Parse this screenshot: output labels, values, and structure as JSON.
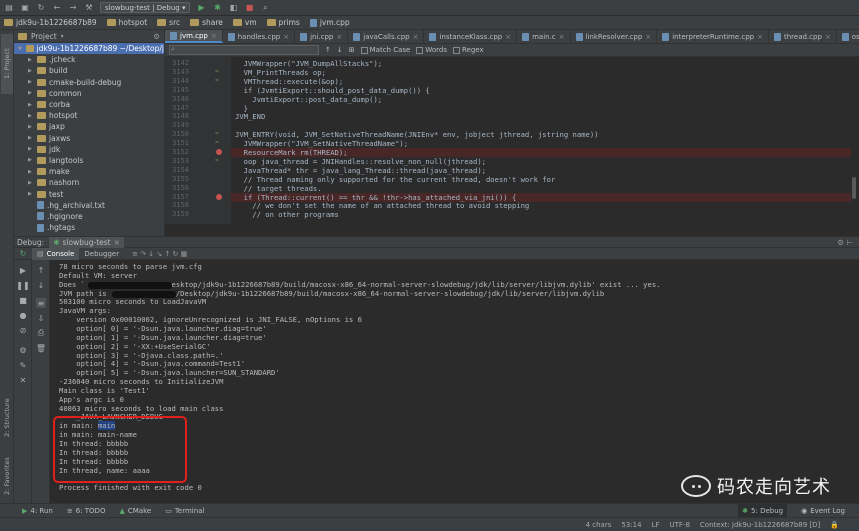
{
  "toolbar": {
    "run_config": "slowbug-test | Debug"
  },
  "breadcrumbs": [
    "jdk9u-1b1226687b89",
    "hotspot",
    "src",
    "share",
    "vm",
    "prims",
    "jvm.cpp"
  ],
  "project": {
    "header": "Project",
    "tree": [
      {
        "label": "jdk9u-1b1226687b89  ~/Desktop/j",
        "type": "folder",
        "depth": 0
      },
      {
        "label": ".jcheck",
        "type": "folder",
        "depth": 1
      },
      {
        "label": "build",
        "type": "folder",
        "depth": 1
      },
      {
        "label": "cmake-build-debug",
        "type": "folder",
        "depth": 1
      },
      {
        "label": "common",
        "type": "folder",
        "depth": 1
      },
      {
        "label": "corba",
        "type": "folder",
        "depth": 1
      },
      {
        "label": "hotspot",
        "type": "folder",
        "depth": 1
      },
      {
        "label": "jaxp",
        "type": "folder",
        "depth": 1
      },
      {
        "label": "jaxws",
        "type": "folder",
        "depth": 1
      },
      {
        "label": "jdk",
        "type": "folder",
        "depth": 1
      },
      {
        "label": "langtools",
        "type": "folder",
        "depth": 1
      },
      {
        "label": "make",
        "type": "folder",
        "depth": 1
      },
      {
        "label": "nashorn",
        "type": "folder",
        "depth": 1
      },
      {
        "label": "test",
        "type": "folder",
        "depth": 1
      },
      {
        "label": ".hg_archival.txt",
        "type": "file",
        "depth": 1
      },
      {
        "label": ".hgignore",
        "type": "file",
        "depth": 1
      },
      {
        "label": ".hgtags",
        "type": "file",
        "depth": 1
      }
    ]
  },
  "tabs": [
    "jvm.cpp",
    "handles.cpp",
    "jni.cpp",
    "javaCalls.cpp",
    "instanceKlass.cpp",
    "main.c",
    "linkResolver.cpp",
    "interpreterRuntime.cpp",
    "thread.cpp",
    "os_bsd.cpp"
  ],
  "search": {
    "match_case": "Match Case",
    "words": "Words",
    "regex": "Regex"
  },
  "editor": {
    "lines": [
      {
        "n": "3142",
        "text": "  JVMWrapper(\"JVM_DumpAllStacks\");"
      },
      {
        "n": "3143",
        "text": "  VM_PrintThreads op;"
      },
      {
        "n": "3144",
        "text": "  VMThread::execute(&op);"
      },
      {
        "n": "3145",
        "text": "  if (JvmtiExport::should_post_data_dump()) {"
      },
      {
        "n": "3146",
        "text": "    JvmtiExport::post_data_dump();"
      },
      {
        "n": "3147",
        "text": "  }"
      },
      {
        "n": "3148",
        "text": "JVM_END"
      },
      {
        "n": "3149",
        "text": ""
      },
      {
        "n": "3150",
        "text": "JVM_ENTRY(void, JVM_SetNativeThreadName(JNIEnv* env, jobject jthread, jstring name))"
      },
      {
        "n": "3151",
        "text": "  JVMWrapper(\"JVM_SetNativeThreadName\");"
      },
      {
        "n": "3152",
        "text": "  ResourceMark rm(THREAD);"
      },
      {
        "n": "3153",
        "text": "  oop java_thread = JNIHandles::resolve_non_null(jthread);"
      },
      {
        "n": "3154",
        "text": "  JavaThread* thr = java_lang_Thread::thread(java_thread);"
      },
      {
        "n": "3155",
        "text": "  // Thread naming only supported for the current thread, doesn't work for"
      },
      {
        "n": "3156",
        "text": "  // target threads."
      },
      {
        "n": "3157",
        "text": "  if (Thread::current() == thr && !thr->has_attached_via_jni()) {"
      },
      {
        "n": "3158",
        "text": "    // we don't set the name of an attached thread to avoid stepping"
      },
      {
        "n": "3159",
        "text": "    // on other programs"
      }
    ]
  },
  "debug": {
    "label": "Debug:",
    "session": "slowbug-test",
    "tabs": [
      "Console",
      "Debugger"
    ]
  },
  "console": {
    "lines": [
      "78 micro seconds to parse jvm.cfg",
      "Default VM: server",
      "Does `                  /Desktop/jdk9u-1b1226687b89/build/macosx-x86_64-normal-server-slowdebug/jdk/lib/server/libjvm.dylib' exist ... yes.",
      "JVM path is                /Desktop/jdk9u-1b1226687b89/build/macosx-x86_64-normal-server-slowdebug/jdk/lib/server/libjvm.dylib",
      "503100 micro seconds to LoadJavaVM",
      "JavaVM args:",
      "    version 0x00010002, ignoreUnrecognized is JNI_FALSE, nOptions is 6",
      "    option[ 0] = '-Dsun.java.launcher.diag=true'",
      "    option[ 1] = '-Dsun.java.launcher.diag=true'",
      "    option[ 2] = '-XX:+UseSerialGC'",
      "    option[ 3] = '-Djava.class.path=.'",
      "    option[ 4] = '-Dsun.java.command=Test1'",
      "    option[ 5] = '-Dsun.java.launcher=SUN_STANDARD'",
      "-236040 micro seconds to InitializeJVM",
      "Main class is 'Test1'",
      "App's argc is 0",
      "40863 micro seconds to load main class",
      "----_JAVA_LAUNCHER_DEBUG----",
      "in main: main",
      "in main: main-name",
      "In thread: bbbbb",
      "In thread: bbbbb",
      "In thread: bbbbb",
      "In thread, name: aaaa",
      "",
      "Process finished with exit code 0"
    ]
  },
  "watermark": "码农走向艺术",
  "left_stripe": {
    "project": "1: Project",
    "structure": "2: Structure",
    "favorites": "2: Favorites"
  },
  "bottom_tools": [
    "4: Run",
    "6: TODO",
    "CMake",
    "Terminal",
    "5: Debug",
    "Event Log"
  ],
  "status": [
    "4 chars",
    "53:14",
    "LF",
    "UTF-8",
    "Context: jdk9u-1b1226687b89 [D]"
  ]
}
